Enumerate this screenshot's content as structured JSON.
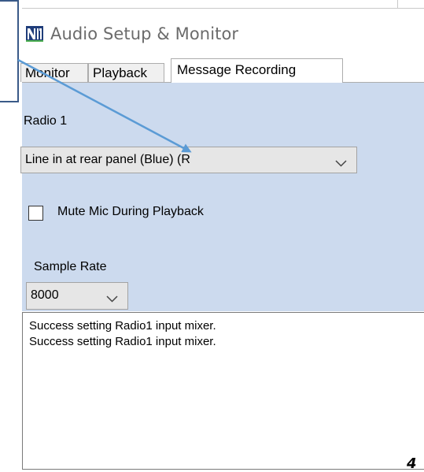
{
  "window": {
    "title": "Audio Setup & Monitor"
  },
  "tabs": [
    {
      "label": "Monitor"
    },
    {
      "label": "Playback"
    },
    {
      "label": "Message Recording",
      "selected": true
    }
  ],
  "recording": {
    "radio_label": "Radio 1",
    "input_select": {
      "value": "Line in at rear panel (Blue) (R"
    },
    "mute_checkbox": {
      "label": "Mute Mic During Playback",
      "checked": false
    },
    "sample_rate_label": "Sample Rate",
    "sample_rate_select": {
      "value": "8000"
    }
  },
  "log": {
    "lines": [
      "Success setting Radio1 input mixer.",
      "Success setting Radio1 input mixer."
    ]
  },
  "page_number": "4",
  "colors": {
    "panel_background": "#ccdaee",
    "annotation_arrow": "#5b9bd5",
    "annotation_bracket": "#3a5a88"
  },
  "icons": {
    "app_icon": "nm-logo-icon",
    "dropdown_chevron": "chevron-down-icon"
  }
}
